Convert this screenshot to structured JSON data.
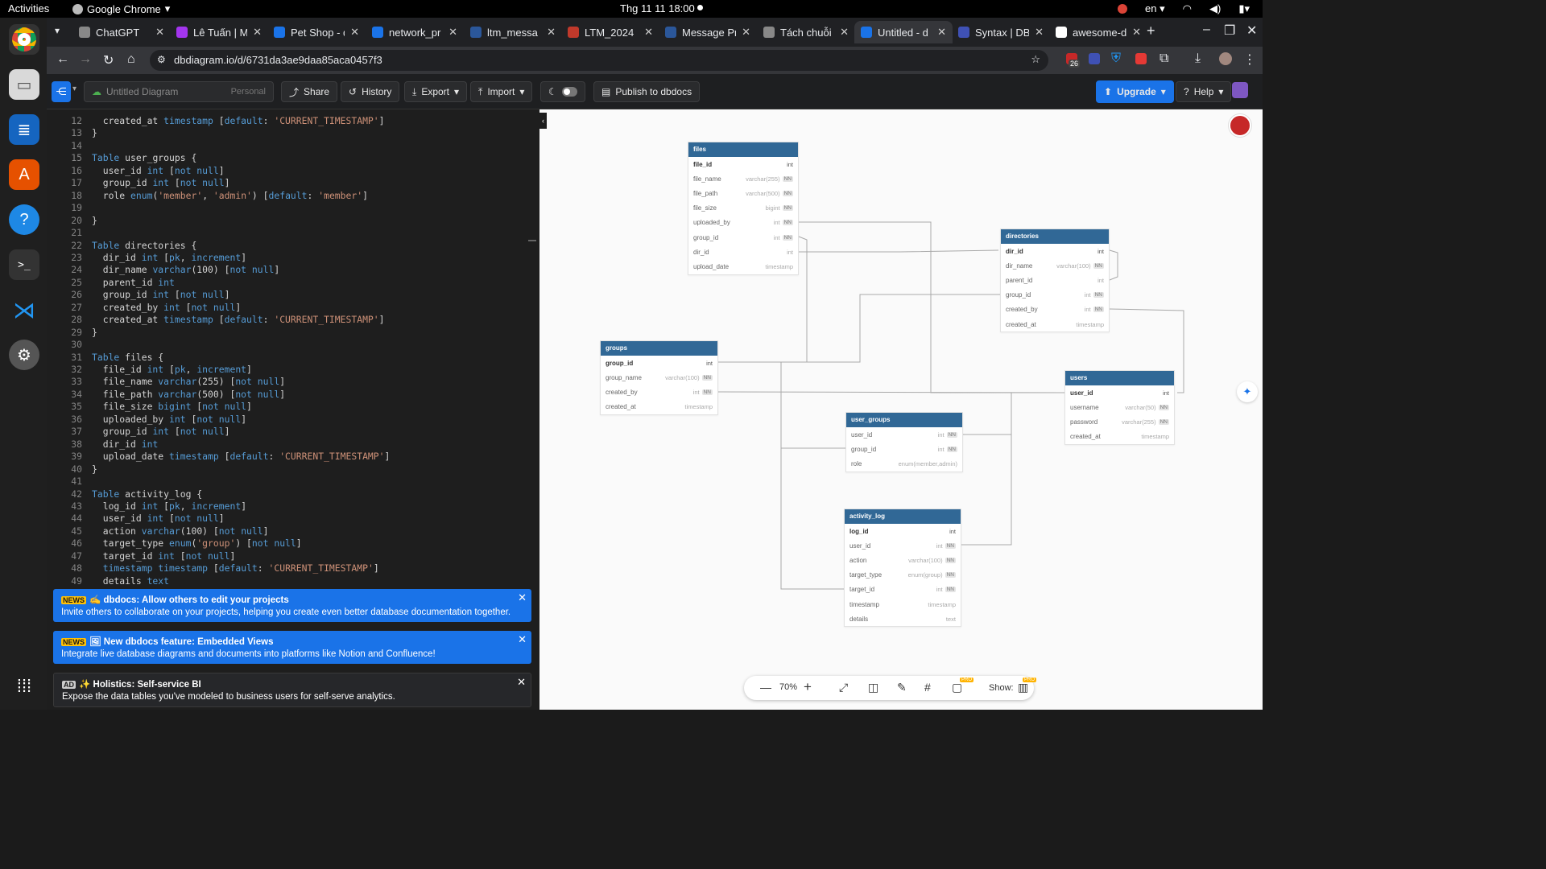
{
  "system": {
    "activities": "Activities",
    "app": "Google Chrome",
    "clock": "Thg 11 11  18:00",
    "lang": "en"
  },
  "tabs": [
    {
      "label": "ChatGPT",
      "color": "#888"
    },
    {
      "label": "Lê Tuấn | M",
      "color": "#a335ee"
    },
    {
      "label": "Pet Shop - d",
      "color": "#1a73e8"
    },
    {
      "label": "network_pr",
      "color": "#1a73e8"
    },
    {
      "label": "ltm_messa",
      "color": "#2b579a"
    },
    {
      "label": "LTM_2024",
      "color": "#c0392b"
    },
    {
      "label": "Message Pr",
      "color": "#2b579a"
    },
    {
      "label": "Tách chuỗi",
      "color": "#888"
    },
    {
      "label": "Untitled - d",
      "color": "#1a73e8"
    },
    {
      "label": "Syntax | DB",
      "color": "#3f51b5"
    },
    {
      "label": "awesome-d",
      "color": "#fff"
    }
  ],
  "url": "dbdiagram.io/d/6731da3ae9daa85aca0457f3",
  "ext_badge": "26",
  "toolbar": {
    "diagram_name": "Untitled Diagram",
    "workspace": "Personal",
    "share": "Share",
    "history": "History",
    "export": "Export",
    "import": "Import",
    "publish": "Publish to dbdocs",
    "upgrade": "Upgrade",
    "help": "Help"
  },
  "editor_lines": [
    {
      "n": "12",
      "c": "  created_at timestamp [default: 'CURRENT_TIMESTAMP']"
    },
    {
      "n": "13",
      "c": "}"
    },
    {
      "n": "14",
      "c": ""
    },
    {
      "n": "15",
      "c": "Table user_groups {"
    },
    {
      "n": "16",
      "c": "  user_id int [not null]"
    },
    {
      "n": "17",
      "c": "  group_id int [not null]"
    },
    {
      "n": "18",
      "c": "  role enum('member', 'admin') [default: 'member']"
    },
    {
      "n": "19",
      "c": ""
    },
    {
      "n": "20",
      "c": "}"
    },
    {
      "n": "21",
      "c": ""
    },
    {
      "n": "22",
      "c": "Table directories {"
    },
    {
      "n": "23",
      "c": "  dir_id int [pk, increment]"
    },
    {
      "n": "24",
      "c": "  dir_name varchar(100) [not null]"
    },
    {
      "n": "25",
      "c": "  parent_id int"
    },
    {
      "n": "26",
      "c": "  group_id int [not null]"
    },
    {
      "n": "27",
      "c": "  created_by int [not null]"
    },
    {
      "n": "28",
      "c": "  created_at timestamp [default: 'CURRENT_TIMESTAMP']"
    },
    {
      "n": "29",
      "c": "}"
    },
    {
      "n": "30",
      "c": ""
    },
    {
      "n": "31",
      "c": "Table files {"
    },
    {
      "n": "32",
      "c": "  file_id int [pk, increment]"
    },
    {
      "n": "33",
      "c": "  file_name varchar(255) [not null]"
    },
    {
      "n": "34",
      "c": "  file_path varchar(500) [not null]"
    },
    {
      "n": "35",
      "c": "  file_size bigint [not null]"
    },
    {
      "n": "36",
      "c": "  uploaded_by int [not null]"
    },
    {
      "n": "37",
      "c": "  group_id int [not null]"
    },
    {
      "n": "38",
      "c": "  dir_id int"
    },
    {
      "n": "39",
      "c": "  upload_date timestamp [default: 'CURRENT_TIMESTAMP']"
    },
    {
      "n": "40",
      "c": "}"
    },
    {
      "n": "41",
      "c": ""
    },
    {
      "n": "42",
      "c": "Table activity_log {"
    },
    {
      "n": "43",
      "c": "  log_id int [pk, increment]"
    },
    {
      "n": "44",
      "c": "  user_id int [not null]"
    },
    {
      "n": "45",
      "c": "  action varchar(100) [not null]"
    },
    {
      "n": "46",
      "c": "  target_type enum('group') [not null]"
    },
    {
      "n": "47",
      "c": "  target_id int [not null]"
    },
    {
      "n": "48",
      "c": "  timestamp timestamp [default: 'CURRENT_TIMESTAMP']"
    },
    {
      "n": "49",
      "c": "  details text"
    }
  ],
  "news": [
    {
      "tag": "NEWS",
      "title": "✍️ dbdocs: Allow others to edit your projects",
      "body": "Invite others to collaborate on your projects, helping you create even better database documentation together.",
      "bg": "#1a73e8"
    },
    {
      "tag": "NEWS",
      "title": "🖼 New dbdocs feature: Embedded Views",
      "body": "Integrate live database diagrams and documents into platforms like Notion and Confluence!",
      "bg": "#1a73e8"
    },
    {
      "tag": "AD",
      "title": "✨ Holistics: Self-service BI",
      "body": "Expose the data tables you've modeled to business users for self-serve analytics.",
      "bg": "#26272a"
    }
  ],
  "tables": [
    {
      "name": "files",
      "rows": [
        [
          "file_id",
          "int",
          false,
          true
        ],
        [
          "file_name",
          "varchar(255)",
          true,
          false
        ],
        [
          "file_path",
          "varchar(500)",
          true,
          false
        ],
        [
          "file_size",
          "bigint",
          true,
          false
        ],
        [
          "uploaded_by",
          "int",
          true,
          false
        ],
        [
          "group_id",
          "int",
          true,
          false
        ],
        [
          "dir_id",
          "int",
          false,
          false
        ],
        [
          "upload_date",
          "timestamp",
          false,
          false
        ]
      ]
    },
    {
      "name": "directories",
      "rows": [
        [
          "dir_id",
          "int",
          false,
          true
        ],
        [
          "dir_name",
          "varchar(100)",
          true,
          false
        ],
        [
          "parent_id",
          "int",
          false,
          false
        ],
        [
          "group_id",
          "int",
          true,
          false
        ],
        [
          "created_by",
          "int",
          true,
          false
        ],
        [
          "created_at",
          "timestamp",
          false,
          false
        ]
      ]
    },
    {
      "name": "groups",
      "rows": [
        [
          "group_id",
          "int",
          false,
          true
        ],
        [
          "group_name",
          "varchar(100)",
          true,
          false
        ],
        [
          "created_by",
          "int",
          true,
          false
        ],
        [
          "created_at",
          "timestamp",
          false,
          false
        ]
      ]
    },
    {
      "name": "users",
      "rows": [
        [
          "user_id",
          "int",
          false,
          true
        ],
        [
          "username",
          "varchar(50)",
          true,
          false
        ],
        [
          "password",
          "varchar(255)",
          true,
          false
        ],
        [
          "created_at",
          "timestamp",
          false,
          false
        ]
      ]
    },
    {
      "name": "user_groups",
      "rows": [
        [
          "user_id",
          "int",
          true,
          false
        ],
        [
          "group_id",
          "int",
          true,
          false
        ],
        [
          "role",
          "enum(member,admin)",
          false,
          false
        ]
      ]
    },
    {
      "name": "activity_log",
      "rows": [
        [
          "log_id",
          "int",
          false,
          true
        ],
        [
          "user_id",
          "int",
          true,
          false
        ],
        [
          "action",
          "varchar(100)",
          true,
          false
        ],
        [
          "target_type",
          "enum(group)",
          true,
          false
        ],
        [
          "target_id",
          "int",
          true,
          false
        ],
        [
          "timestamp",
          "timestamp",
          false,
          false
        ],
        [
          "details",
          "text",
          false,
          false
        ]
      ]
    }
  ],
  "nn_label": "NN",
  "zoom": {
    "level": "70%",
    "show_label": "Show:",
    "pro": "PRO"
  }
}
